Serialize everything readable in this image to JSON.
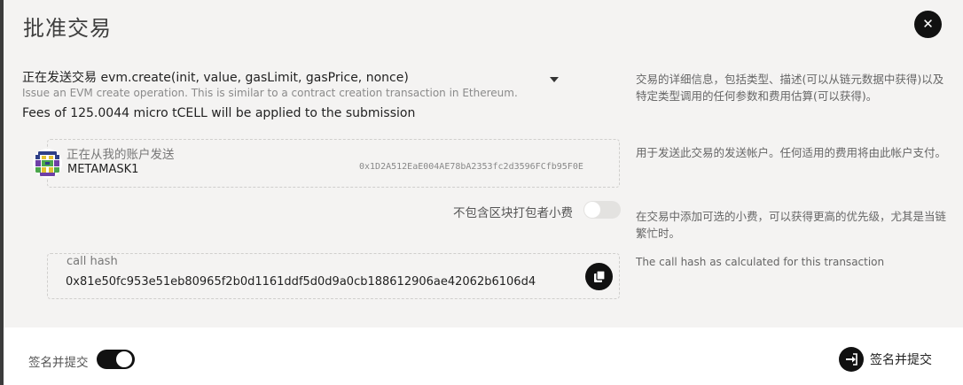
{
  "modal": {
    "title": "批准交易",
    "close_symbol": "✕"
  },
  "call": {
    "prefix": "正在发送交易",
    "method": "evm.create(init, value, gasLimit, gasPrice, nonce)",
    "description": "Issue an EVM create operation. This is similar to a contract creation transaction in Ethereum.",
    "fees": "Fees of 125.0044 micro tCELL will be applied to the submission",
    "help": "交易的详细信息，包括类型、描述(可以从链元数据中获得)以及特定类型调用的任何参数和费用估算(可以获得)。"
  },
  "account": {
    "label": "正在从我的账户发送",
    "name": "METAMASK1",
    "address": "0x1D2A512EaE004AE78bA2353fc2d3596FCfb95F0E",
    "help": "用于发送此交易的发送帐户。任何适用的费用将由此帐户支付。"
  },
  "tip": {
    "label": "不包含区块打包者小费",
    "enabled": false,
    "help": "在交易中添加可选的小费，可以获得更高的优先级，尤其是当链繁忙时。"
  },
  "hash": {
    "label": "call hash",
    "value": "0x81e50fc953e51eb80965f2b0d1161ddf5d0d9a0cb188612906ae42062b6106d4",
    "help": "The call hash as calculated for this transaction"
  },
  "footer": {
    "sign_label": "签名并提交",
    "sign_enabled": true,
    "submit_label": "签名并提交"
  },
  "icons": {
    "close": "close-icon",
    "dropdown": "caret-down-icon",
    "copy": "copy-icon",
    "submit": "sign-in-icon",
    "avatar": "identicon"
  }
}
